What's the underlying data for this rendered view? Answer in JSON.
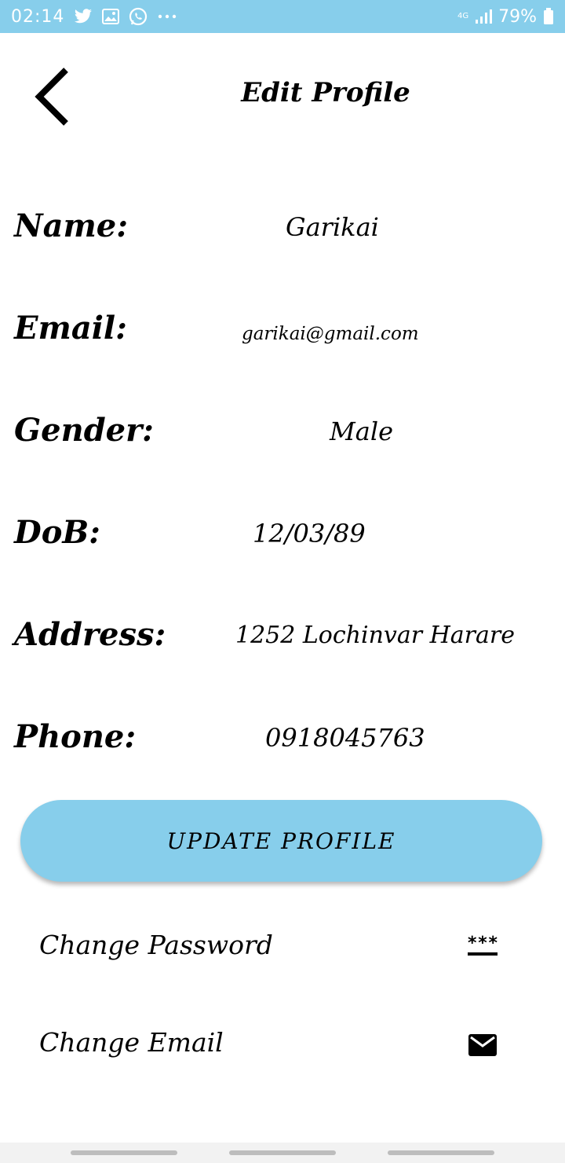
{
  "status_bar": {
    "time": "02:14",
    "network": "4G",
    "battery": "79%",
    "icons": [
      "twitter-icon",
      "gallery-icon",
      "whatsapp-icon",
      "more-dots-icon",
      "signal-icon",
      "battery-icon"
    ]
  },
  "header": {
    "title": "Edit Profile",
    "back_icon": "chevron-left-icon"
  },
  "profile": {
    "fields": [
      {
        "label": "Name:",
        "value": "Garikai"
      },
      {
        "label": "Email:",
        "value": "garikai@gmail.com"
      },
      {
        "label": "Gender:",
        "value": "Male"
      },
      {
        "label": "DoB:",
        "value": "12/03/89"
      },
      {
        "label": "Address:",
        "value": "1252 Lochinvar Harare"
      },
      {
        "label": "Phone:",
        "value": "0918045763"
      }
    ]
  },
  "actions": {
    "update_label": "UPDATE PROFILE",
    "change_password_label": "Change Password",
    "change_password_icon_text": "***",
    "change_email_label": "Change Email"
  },
  "colors": {
    "accent": "#87CEEB",
    "text": "#000000",
    "background": "#FFFFFF"
  }
}
